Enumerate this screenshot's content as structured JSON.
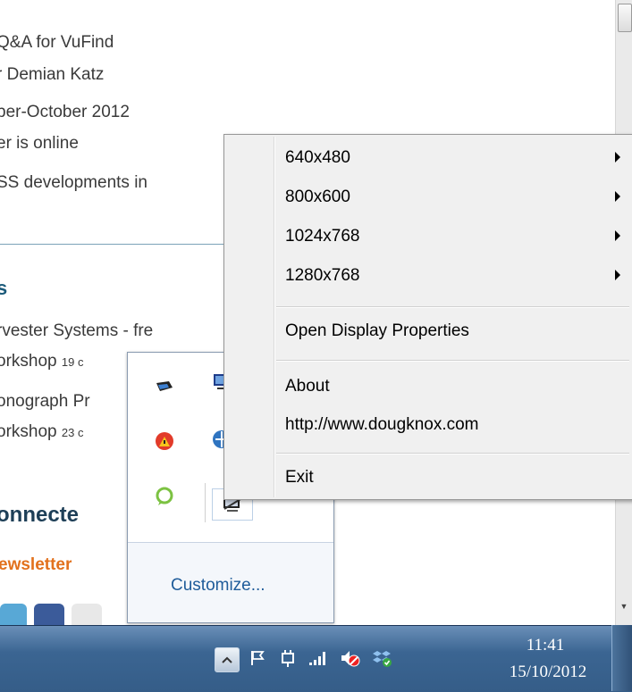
{
  "background_page": {
    "lines": [
      "Q&A for VuFind",
      "r Demian Katz",
      "ber-October 2012",
      "er is online",
      "SS developments in",
      "s",
      "rvester Systems - fre",
      "orkshop",
      "19 c",
      "onograph Pr",
      "orkshop",
      "23 c",
      "onnecte",
      "ewsletter"
    ]
  },
  "context_menu": {
    "items": [
      {
        "label": "640x480",
        "submenu": true
      },
      {
        "label": "800x600",
        "submenu": true
      },
      {
        "label": "1024x768",
        "submenu": true
      },
      {
        "label": "1280x768",
        "submenu": true
      },
      {
        "label": "Open Display Properties",
        "submenu": false
      },
      {
        "label": "About",
        "submenu": false
      },
      {
        "label": "http://www.dougknox.com",
        "submenu": false
      },
      {
        "label": "Exit",
        "submenu": false
      }
    ]
  },
  "tray_popup": {
    "customize_label": "Customize..."
  },
  "taskbar": {
    "time": "11:41",
    "date": "15/10/2012"
  },
  "colors": {
    "taskbar": "#3b6592",
    "menu_bg": "#f0f0f0",
    "link_blue": "#1f5c9a",
    "heading_blue": "#1b5a7a",
    "orange": "#e2711d"
  }
}
